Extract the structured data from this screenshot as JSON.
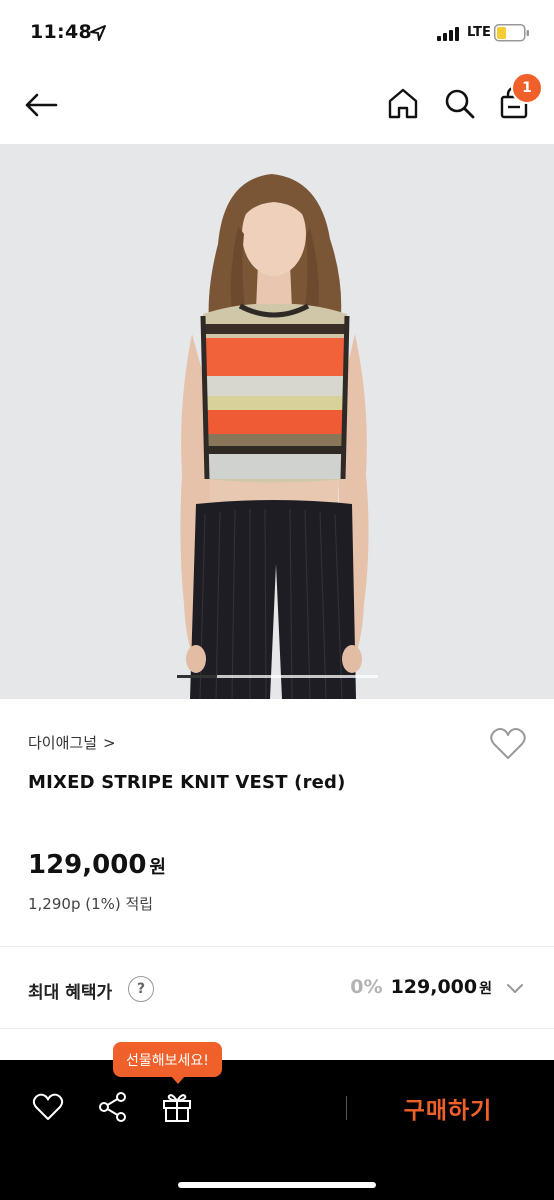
{
  "status_bar": {
    "time": "11:48",
    "network": "LTE",
    "battery_color": "#f5cc32"
  },
  "header": {
    "back_icon": "arrow-left-icon",
    "home_icon": "home-icon",
    "search_icon": "search-icon",
    "cart_icon": "shopping-bag-icon",
    "cart_badge": "1",
    "accent_color": "#f0602a"
  },
  "gallery": {
    "current_index": 1,
    "progress_fraction": 0.2
  },
  "product": {
    "brand": "다이애그널",
    "brand_chevron": ">",
    "name": "MIXED STRIPE KNIT VEST (red)",
    "price": "129,000",
    "price_unit": "원",
    "points": "1,290p (1%) 적립",
    "wish_icon": "heart-outline-icon"
  },
  "benefit": {
    "label": "최대 혜택가",
    "help": "?",
    "rate": "0%",
    "price": "129,000",
    "unit": "원",
    "expand_icon": "chevron-down-icon"
  },
  "bottom_bar": {
    "wish_icon": "heart-icon",
    "share_icon": "share-icon",
    "gift_icon": "gift-icon",
    "gift_tooltip": "선물해보세요!",
    "buy_label": "구매하기"
  }
}
